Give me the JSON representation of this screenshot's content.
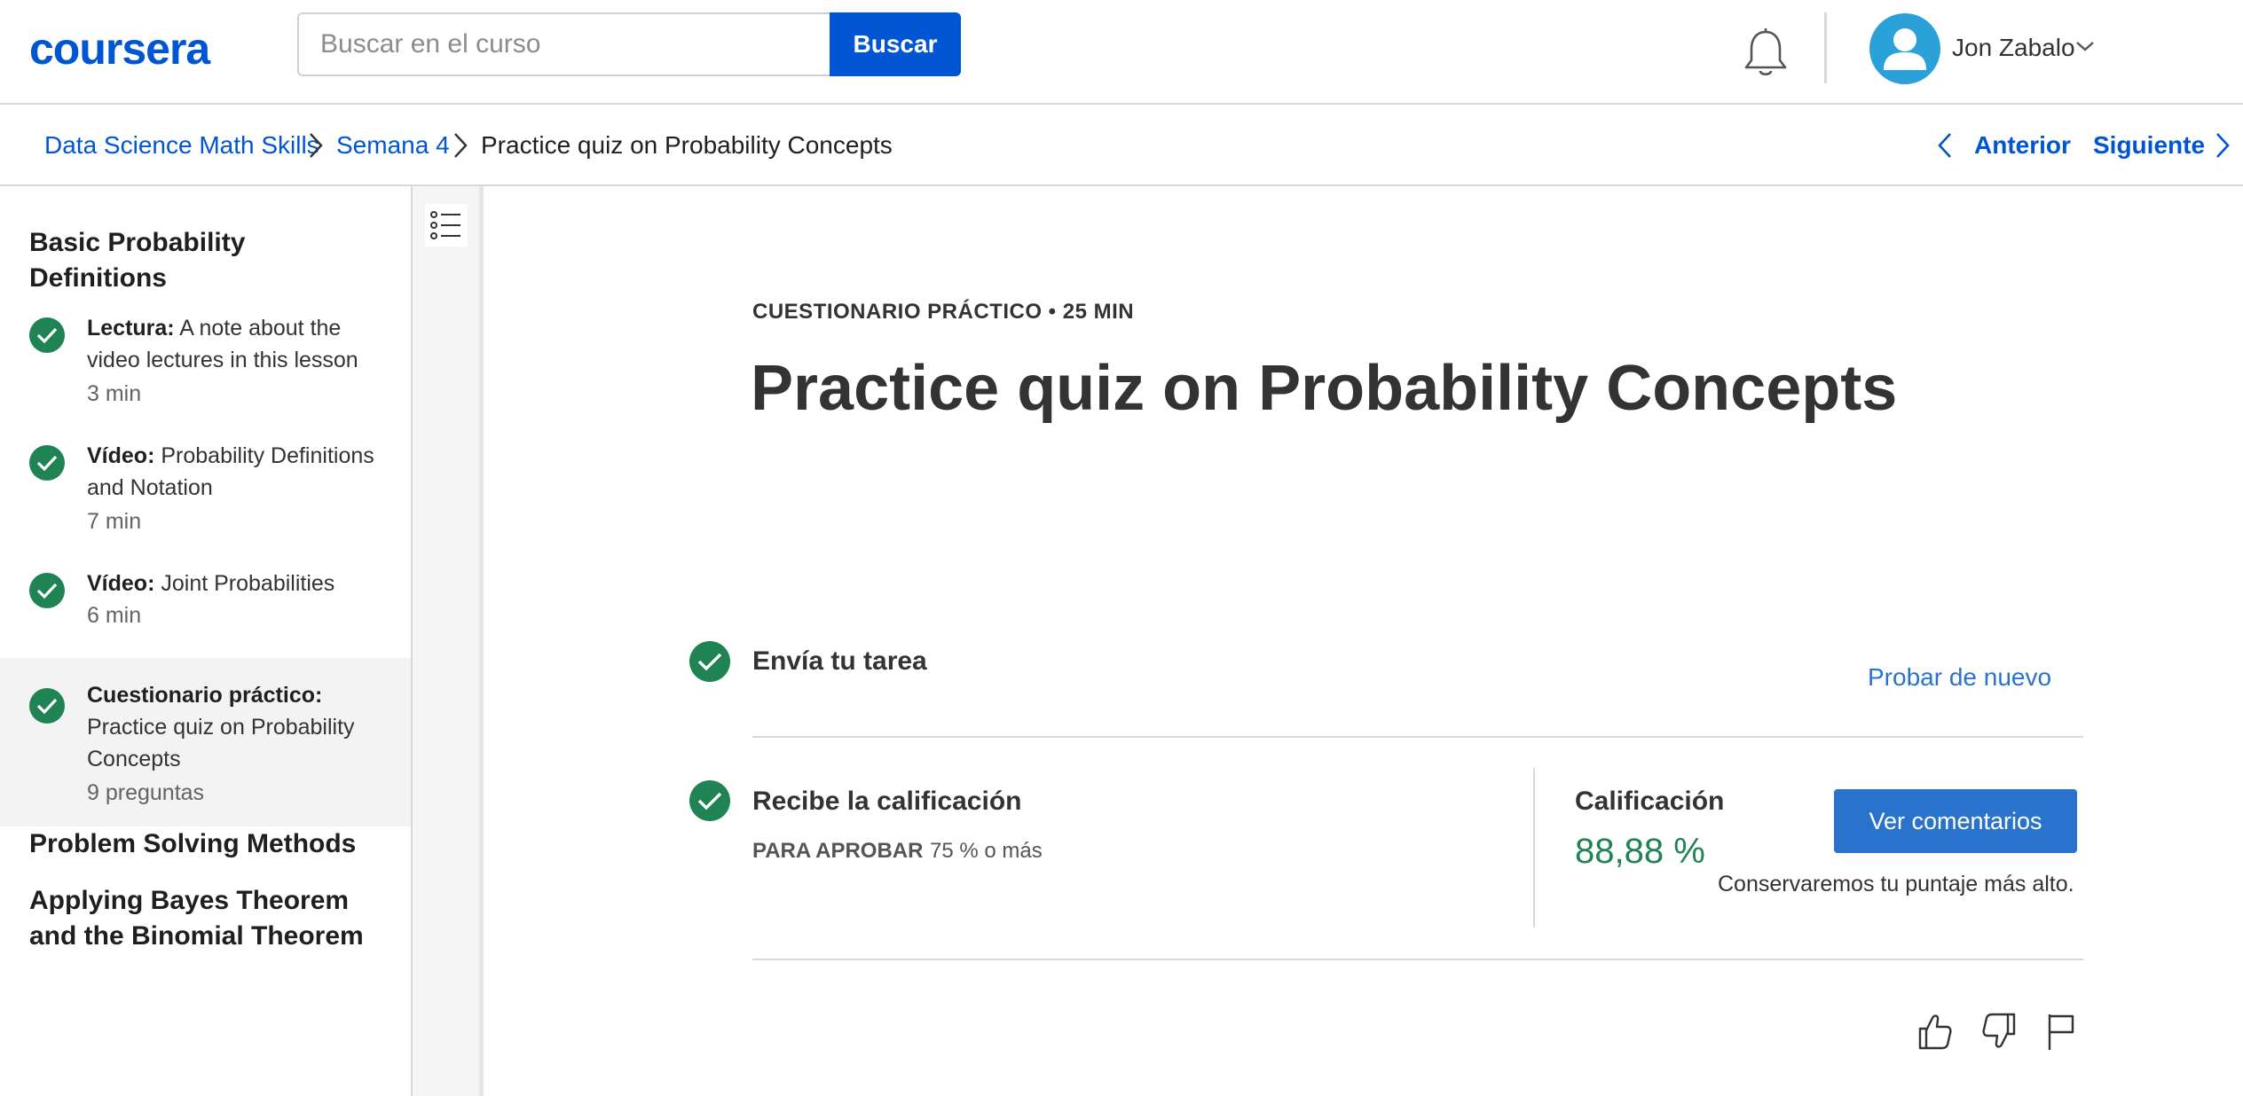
{
  "header": {
    "logo_text": "coursera",
    "search_placeholder": "Buscar en el curso",
    "search_button": "Buscar",
    "user_name": "Jon Zabalo"
  },
  "breadcrumb": {
    "items": [
      "Data Science Math Skills",
      "Semana 4",
      "Practice quiz on Probability Concepts"
    ],
    "prev_label": "Anterior",
    "next_label": "Siguiente"
  },
  "sidebar": {
    "section_current": "Basic Probability Definitions",
    "items": [
      {
        "type": "Lectura:",
        "title": "A note about the video lectures in this lesson",
        "meta": "3 min",
        "done": true
      },
      {
        "type": "Vídeo:",
        "title": "Probability Definitions and Notation",
        "meta": "7 min",
        "done": true
      },
      {
        "type": "Vídeo:",
        "title": "Joint Probabilities",
        "meta": "6 min",
        "done": true
      },
      {
        "type": "Cuestionario práctico:",
        "title": "Practice quiz on Probability Concepts",
        "meta": "9 preguntas",
        "done": true,
        "active": true
      }
    ],
    "other_sections": [
      "Problem Solving Methods",
      "Applying Bayes Theorem and the Binomial Theorem"
    ]
  },
  "main": {
    "kicker": "CUESTIONARIO PRÁCTICO • 25 MIN",
    "title": "Practice quiz on Probability Concepts",
    "submit_step": "Envía tu tarea",
    "retry_label": "Probar de nuevo",
    "grade_step": "Recibe la calificación",
    "pass_label": "PARA APROBAR",
    "pass_value": "75 % o más",
    "grade_label": "Calificación",
    "grade_value": "88,88 %",
    "feedback_button": "Ver comentarios",
    "keep_note": "Conservaremos tu puntaje más alto."
  },
  "icons": [
    "bell-icon",
    "user-avatar-icon",
    "chevron-down-icon",
    "chevron-right-icon",
    "chevron-left-icon",
    "list-icon",
    "check-icon",
    "thumbs-up-icon",
    "thumbs-down-icon",
    "flag-icon"
  ],
  "colors": {
    "brand": "#0056d2",
    "success": "#1f8354",
    "button": "#2a73cc"
  }
}
